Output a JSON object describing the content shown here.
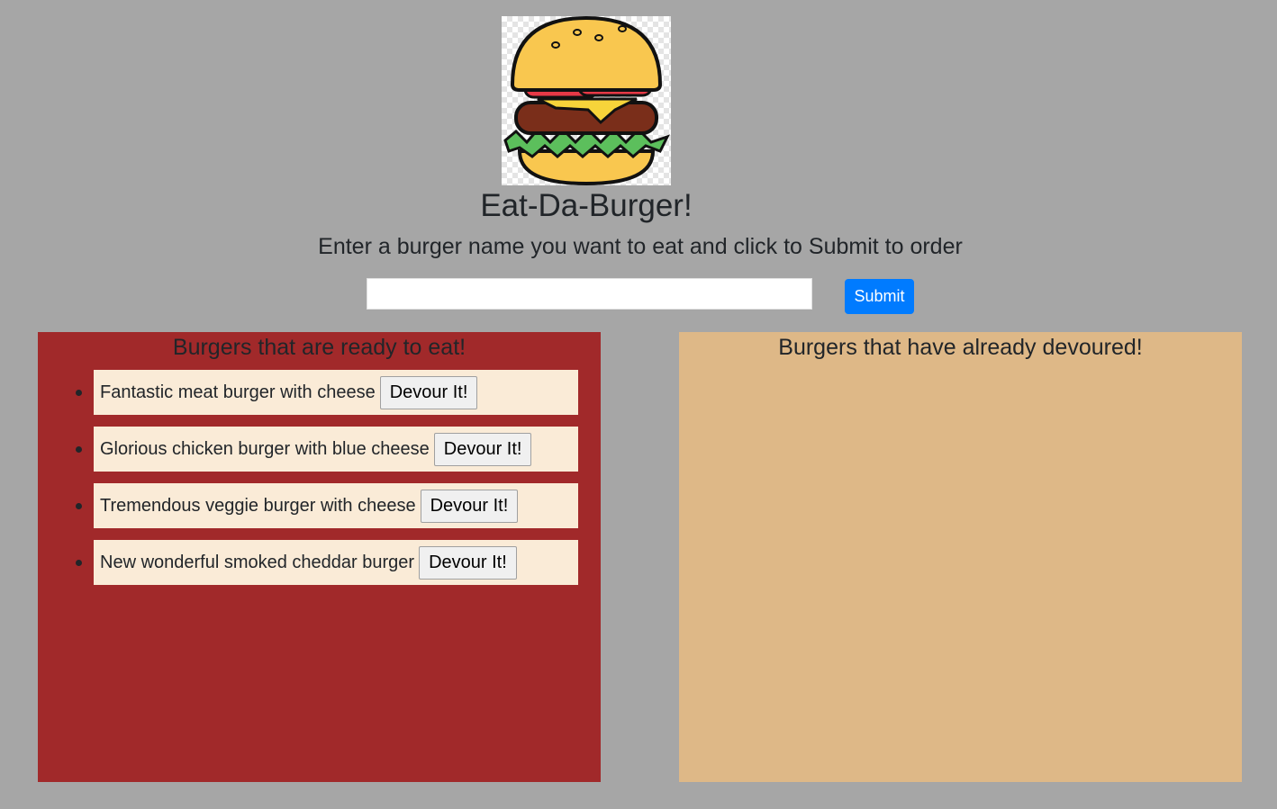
{
  "app": {
    "title": "Eat-Da-Burger!",
    "subtitle": "Enter a burger name you want to eat and click to Submit to order"
  },
  "form": {
    "input_value": "",
    "input_placeholder": "",
    "submit_label": "Submit"
  },
  "ready": {
    "heading": "Burgers that are ready to eat!",
    "items": [
      {
        "name": "Fantastic meat burger with cheese",
        "button": "Devour It!"
      },
      {
        "name": "Glorious chicken burger with blue cheese",
        "button": "Devour It!"
      },
      {
        "name": "Tremendous veggie burger with cheese",
        "button": "Devour It!"
      },
      {
        "name": "New wonderful smoked cheddar burger",
        "button": "Devour It!"
      }
    ]
  },
  "devoured": {
    "heading": "Burgers that have already devoured!",
    "items": []
  },
  "colors": {
    "page_background": "#a6a6a6",
    "ready_panel": "#a1292a",
    "devoured_panel": "#deb887",
    "list_item": "#faebd7",
    "submit": "#007bff"
  }
}
